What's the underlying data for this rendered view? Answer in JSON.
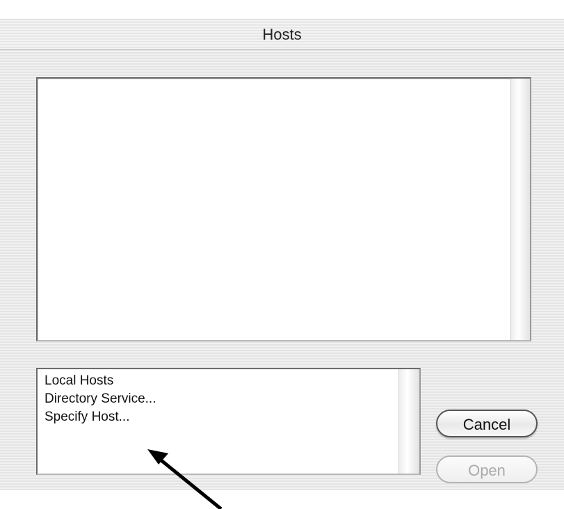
{
  "window": {
    "title": "Hosts"
  },
  "hosts_list": {
    "items": []
  },
  "sources": {
    "items": [
      {
        "label": "Local Hosts"
      },
      {
        "label": "Directory Service..."
      },
      {
        "label": "Specify Host..."
      }
    ]
  },
  "buttons": {
    "cancel": "Cancel",
    "open": "Open"
  },
  "annotation": {
    "arrow_icon": "arrow-pointer",
    "color": "#000000"
  }
}
